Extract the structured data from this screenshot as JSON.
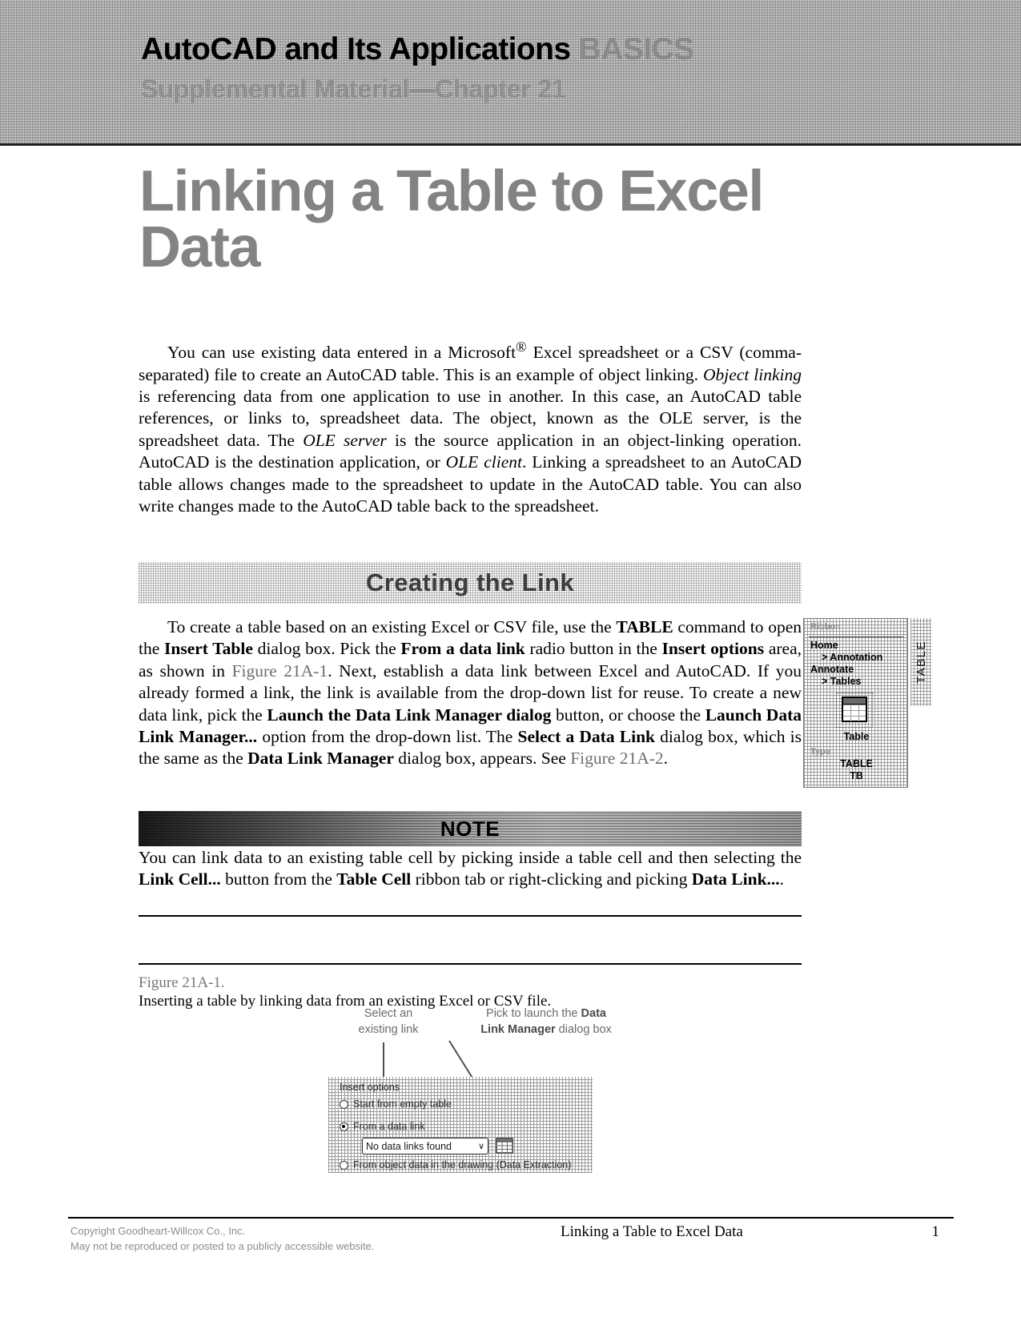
{
  "banner": {
    "title_black": "AutoCAD and Its Applications",
    "title_gray": "BASICS",
    "subtitle": "Supplemental Material—Chapter 21"
  },
  "page_title": "Linking a Table to Excel Data",
  "intro_paragraph": {
    "s1": "You can use existing data entered in a Microsoft",
    "sup": "®",
    "s2": " Excel spreadsheet or a CSV (comma-separated) file to create an AutoCAD table. This is an example of object linking. ",
    "em1": "Object linking",
    "s3": " is referencing data from one application to use in another. In this case, an AutoCAD table references, or links to, spreadsheet data. The object, known as the OLE server, is the spreadsheet data. The ",
    "em2": "OLE server",
    "s4": " is the source application in an object-linking operation. AutoCAD is the destination application, or ",
    "em3": "OLE client",
    "s5": ". Linking a spreadsheet to an AutoCAD table allows changes made to the spreadsheet to update in the AutoCAD table. You can also write changes made to the AutoCAD table back to the spreadsheet."
  },
  "section": {
    "heading": "Creating the Link"
  },
  "link_paragraph": {
    "s1": "To create a table based on an existing Excel or CSV file, use the ",
    "b1": "TABLE",
    "s2": " command to open the ",
    "b2": "Insert Table",
    "s3": " dialog box. Pick the ",
    "b3": "From a data link",
    "s4": " radio button in the ",
    "b4": "Insert options",
    "s5": " area, as shown in ",
    "figref1": "Figure 21A-1",
    "s6": ". Next, establish a data link between Excel and AutoCAD. If you already formed a link, the link is available from the drop-down list for reuse. To create a new data link, pick the ",
    "b5": "Launch the Data Link Manager dialog",
    "s7": " button, or choose the ",
    "b6": "Launch Data Link Manager...",
    "s8": " option from the drop-down list. The ",
    "b7": "Select a Data Link",
    "s9": " dialog box, which is the same as the ",
    "b8": "Data Link Manager",
    "s10": " dialog box, appears. See ",
    "figref2": "Figure 21A-2",
    "s11": "."
  },
  "ribbon_box": {
    "caption": "Ribbon",
    "path_line1": "Home",
    "path_line2": "> Annotation",
    "path_line3": "Annotate",
    "path_line4": "> Tables",
    "icon_label": "Table",
    "type_caption": "Type",
    "command_line1": "TABLE",
    "command_line2": "TB",
    "tab_label": "TABLE"
  },
  "note": {
    "title": "NOTE",
    "s1": "You can link data to an existing table cell by picking inside a table cell and then selecting the ",
    "b1": "Link Cell...",
    "s2": " button from the ",
    "b2": "Table Cell",
    "s3": " ribbon tab or right-clicking and picking ",
    "b3": "Data Link...",
    "s4": "."
  },
  "figure": {
    "number": "Figure 21A-1.",
    "caption": "Inserting a table by linking data from an existing Excel or CSV file.",
    "annotation_left_l1": "Select an",
    "annotation_left_l2": "existing link",
    "annotation_right_l1_plain": "Pick to launch the ",
    "annotation_right_l1_bold": "Data",
    "annotation_right_l2_bold": "Link Manager",
    "annotation_right_l2_plain": " dialog box",
    "dialog": {
      "group_label": "Insert options",
      "radio_empty": "Start from empty table",
      "radio_datalink": "From a data link",
      "radio_object": "From object data in the drawing (Data Extraction)",
      "selected_radio": "From a data link",
      "combo_value": "No data links found",
      "combo_chevron": "∨",
      "launch_button_name": "launch-data-link-manager-button"
    }
  },
  "footer": {
    "copyright_line1": "Copyright Goodheart-Willcox Co., Inc.",
    "copyright_line2": "May not be reproduced or posted to a publicly accessible website.",
    "running_title": "Linking a Table to Excel Data",
    "page_number": "1"
  }
}
